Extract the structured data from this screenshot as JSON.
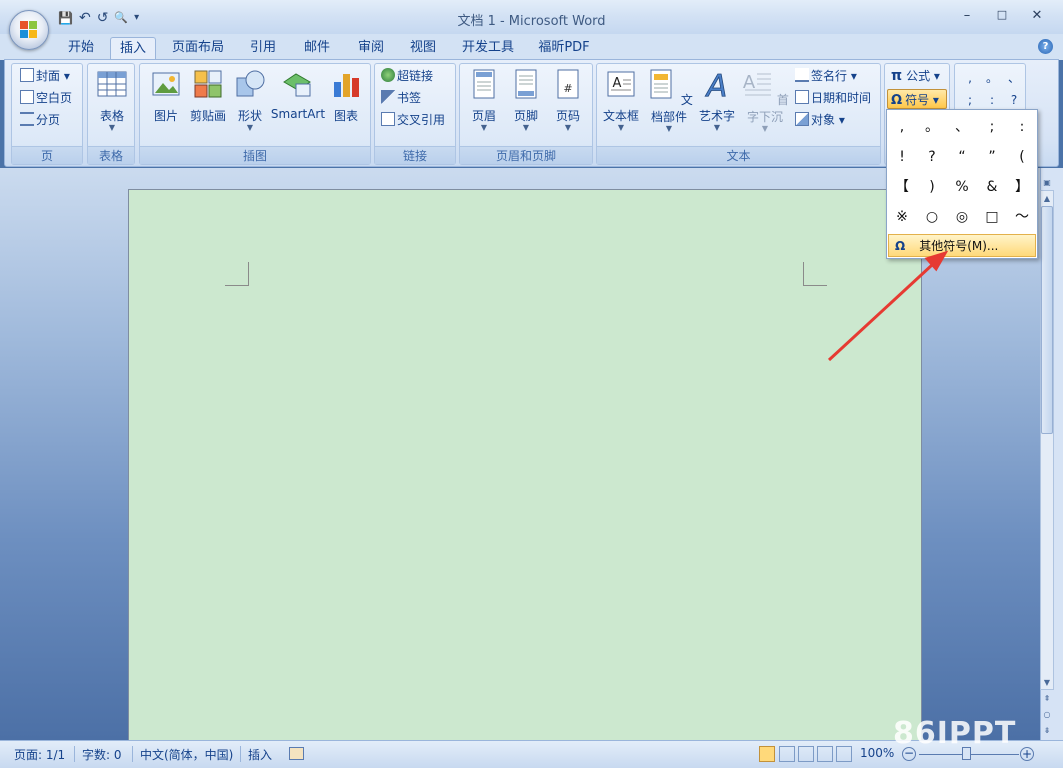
{
  "window": {
    "title": "文档 1 - Microsoft Word",
    "minimize": "–",
    "maximize": "□",
    "close": "✕"
  },
  "qat": {
    "save": "💾",
    "undo": "↶",
    "redo": "↺",
    "print_preview": "🔍",
    "customize": "▾"
  },
  "tabs": [
    "开始",
    "插入",
    "页面布局",
    "引用",
    "邮件",
    "审阅",
    "视图",
    "开发工具",
    "福昕PDF"
  ],
  "active_tab": "插入",
  "help": "?",
  "groups": {
    "page": {
      "label": "页",
      "items": [
        "封面",
        "空白页",
        "分页"
      ]
    },
    "table": {
      "label": "表格",
      "items": [
        "表格"
      ]
    },
    "illustrations": {
      "label": "插图",
      "items": [
        "图片",
        "剪贴画",
        "形状",
        "SmartArt",
        "图表"
      ]
    },
    "links": {
      "label": "链接",
      "items": [
        "超链接",
        "书签",
        "交叉引用"
      ]
    },
    "header_footer": {
      "label": "页眉和页脚",
      "items": [
        "页眉",
        "页脚",
        "页码"
      ]
    },
    "text": {
      "label": "文本",
      "items": [
        "文本框",
        "文档部件",
        "艺术字",
        "首字下沉",
        "签名行",
        "日期和时间",
        "对象"
      ]
    },
    "symbols": {
      "formula": "公式",
      "symbol": "符号",
      "pi": "π",
      "omega": "Ω"
    }
  },
  "quick_symbols": [
    ",",
    "。",
    "、",
    ";",
    ":",
    "?"
  ],
  "dropdown": {
    "symbols": [
      ",",
      "。",
      "、",
      ";",
      ":",
      "!",
      "?",
      "“",
      "”",
      "(",
      "【",
      ")",
      "%",
      "&",
      "】",
      "※",
      "○",
      "◎",
      "□",
      "～"
    ],
    "more_label": "其他符号(M)...",
    "more_icon": "Ω"
  },
  "status": {
    "page": "页面: 1/1",
    "words": "字数: 0",
    "language": "中文(简体，中国)",
    "mode": "插入",
    "zoom": "100%"
  },
  "watermark": "86IPPT",
  "colors": {
    "page_bg": "#cce8cf",
    "accent": "#15428b",
    "arrow": "#e63a32"
  }
}
